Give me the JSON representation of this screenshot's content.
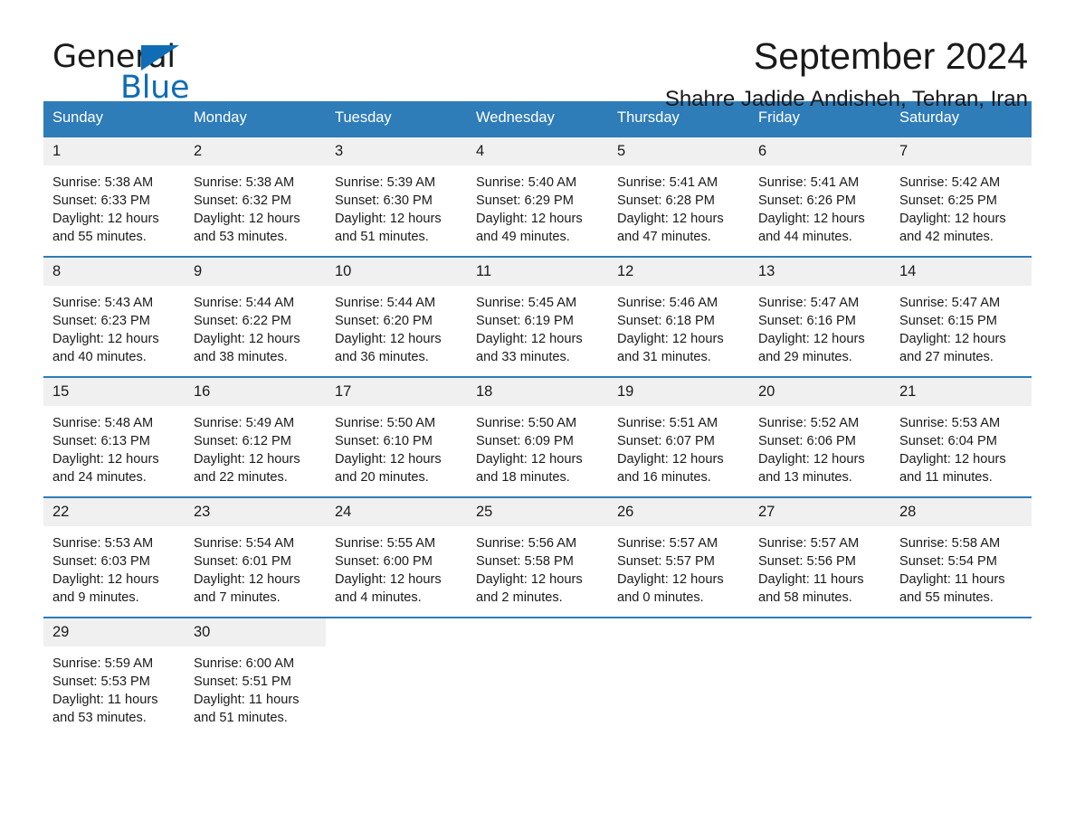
{
  "brand": {
    "name_part1": "General",
    "name_part2": "Blue",
    "triangle_color": "#0f6cb5"
  },
  "header": {
    "title": "September 2024",
    "subtitle": "Shahre Jadide Andisheh, Tehran, Iran"
  },
  "theme": {
    "header_blue": "#2e7cb8",
    "date_band_gray": "#f0f0f0",
    "text_color": "#1a1a1a",
    "page_background": "#ffffff"
  },
  "calendar": {
    "weekday_headers": [
      "Sunday",
      "Monday",
      "Tuesday",
      "Wednesday",
      "Thursday",
      "Friday",
      "Saturday"
    ],
    "labels": {
      "sunrise_prefix": "Sunrise:",
      "sunset_prefix": "Sunset:",
      "daylight_prefix": "Daylight:"
    },
    "weeks": [
      [
        {
          "day": "1",
          "sunrise": "Sunrise: 5:38 AM",
          "sunset": "Sunset: 6:33 PM",
          "daylight": "Daylight: 12 hours and 55 minutes."
        },
        {
          "day": "2",
          "sunrise": "Sunrise: 5:38 AM",
          "sunset": "Sunset: 6:32 PM",
          "daylight": "Daylight: 12 hours and 53 minutes."
        },
        {
          "day": "3",
          "sunrise": "Sunrise: 5:39 AM",
          "sunset": "Sunset: 6:30 PM",
          "daylight": "Daylight: 12 hours and 51 minutes."
        },
        {
          "day": "4",
          "sunrise": "Sunrise: 5:40 AM",
          "sunset": "Sunset: 6:29 PM",
          "daylight": "Daylight: 12 hours and 49 minutes."
        },
        {
          "day": "5",
          "sunrise": "Sunrise: 5:41 AM",
          "sunset": "Sunset: 6:28 PM",
          "daylight": "Daylight: 12 hours and 47 minutes."
        },
        {
          "day": "6",
          "sunrise": "Sunrise: 5:41 AM",
          "sunset": "Sunset: 6:26 PM",
          "daylight": "Daylight: 12 hours and 44 minutes."
        },
        {
          "day": "7",
          "sunrise": "Sunrise: 5:42 AM",
          "sunset": "Sunset: 6:25 PM",
          "daylight": "Daylight: 12 hours and 42 minutes."
        }
      ],
      [
        {
          "day": "8",
          "sunrise": "Sunrise: 5:43 AM",
          "sunset": "Sunset: 6:23 PM",
          "daylight": "Daylight: 12 hours and 40 minutes."
        },
        {
          "day": "9",
          "sunrise": "Sunrise: 5:44 AM",
          "sunset": "Sunset: 6:22 PM",
          "daylight": "Daylight: 12 hours and 38 minutes."
        },
        {
          "day": "10",
          "sunrise": "Sunrise: 5:44 AM",
          "sunset": "Sunset: 6:20 PM",
          "daylight": "Daylight: 12 hours and 36 minutes."
        },
        {
          "day": "11",
          "sunrise": "Sunrise: 5:45 AM",
          "sunset": "Sunset: 6:19 PM",
          "daylight": "Daylight: 12 hours and 33 minutes."
        },
        {
          "day": "12",
          "sunrise": "Sunrise: 5:46 AM",
          "sunset": "Sunset: 6:18 PM",
          "daylight": "Daylight: 12 hours and 31 minutes."
        },
        {
          "day": "13",
          "sunrise": "Sunrise: 5:47 AM",
          "sunset": "Sunset: 6:16 PM",
          "daylight": "Daylight: 12 hours and 29 minutes."
        },
        {
          "day": "14",
          "sunrise": "Sunrise: 5:47 AM",
          "sunset": "Sunset: 6:15 PM",
          "daylight": "Daylight: 12 hours and 27 minutes."
        }
      ],
      [
        {
          "day": "15",
          "sunrise": "Sunrise: 5:48 AM",
          "sunset": "Sunset: 6:13 PM",
          "daylight": "Daylight: 12 hours and 24 minutes."
        },
        {
          "day": "16",
          "sunrise": "Sunrise: 5:49 AM",
          "sunset": "Sunset: 6:12 PM",
          "daylight": "Daylight: 12 hours and 22 minutes."
        },
        {
          "day": "17",
          "sunrise": "Sunrise: 5:50 AM",
          "sunset": "Sunset: 6:10 PM",
          "daylight": "Daylight: 12 hours and 20 minutes."
        },
        {
          "day": "18",
          "sunrise": "Sunrise: 5:50 AM",
          "sunset": "Sunset: 6:09 PM",
          "daylight": "Daylight: 12 hours and 18 minutes."
        },
        {
          "day": "19",
          "sunrise": "Sunrise: 5:51 AM",
          "sunset": "Sunset: 6:07 PM",
          "daylight": "Daylight: 12 hours and 16 minutes."
        },
        {
          "day": "20",
          "sunrise": "Sunrise: 5:52 AM",
          "sunset": "Sunset: 6:06 PM",
          "daylight": "Daylight: 12 hours and 13 minutes."
        },
        {
          "day": "21",
          "sunrise": "Sunrise: 5:53 AM",
          "sunset": "Sunset: 6:04 PM",
          "daylight": "Daylight: 12 hours and 11 minutes."
        }
      ],
      [
        {
          "day": "22",
          "sunrise": "Sunrise: 5:53 AM",
          "sunset": "Sunset: 6:03 PM",
          "daylight": "Daylight: 12 hours and 9 minutes."
        },
        {
          "day": "23",
          "sunrise": "Sunrise: 5:54 AM",
          "sunset": "Sunset: 6:01 PM",
          "daylight": "Daylight: 12 hours and 7 minutes."
        },
        {
          "day": "24",
          "sunrise": "Sunrise: 5:55 AM",
          "sunset": "Sunset: 6:00 PM",
          "daylight": "Daylight: 12 hours and 4 minutes."
        },
        {
          "day": "25",
          "sunrise": "Sunrise: 5:56 AM",
          "sunset": "Sunset: 5:58 PM",
          "daylight": "Daylight: 12 hours and 2 minutes."
        },
        {
          "day": "26",
          "sunrise": "Sunrise: 5:57 AM",
          "sunset": "Sunset: 5:57 PM",
          "daylight": "Daylight: 12 hours and 0 minutes."
        },
        {
          "day": "27",
          "sunrise": "Sunrise: 5:57 AM",
          "sunset": "Sunset: 5:56 PM",
          "daylight": "Daylight: 11 hours and 58 minutes."
        },
        {
          "day": "28",
          "sunrise": "Sunrise: 5:58 AM",
          "sunset": "Sunset: 5:54 PM",
          "daylight": "Daylight: 11 hours and 55 minutes."
        }
      ],
      [
        {
          "day": "29",
          "sunrise": "Sunrise: 5:59 AM",
          "sunset": "Sunset: 5:53 PM",
          "daylight": "Daylight: 11 hours and 53 minutes."
        },
        {
          "day": "30",
          "sunrise": "Sunrise: 6:00 AM",
          "sunset": "Sunset: 5:51 PM",
          "daylight": "Daylight: 11 hours and 51 minutes."
        },
        {
          "day": "",
          "sunrise": "",
          "sunset": "",
          "daylight": ""
        },
        {
          "day": "",
          "sunrise": "",
          "sunset": "",
          "daylight": ""
        },
        {
          "day": "",
          "sunrise": "",
          "sunset": "",
          "daylight": ""
        },
        {
          "day": "",
          "sunrise": "",
          "sunset": "",
          "daylight": ""
        },
        {
          "day": "",
          "sunrise": "",
          "sunset": "",
          "daylight": ""
        }
      ]
    ]
  }
}
